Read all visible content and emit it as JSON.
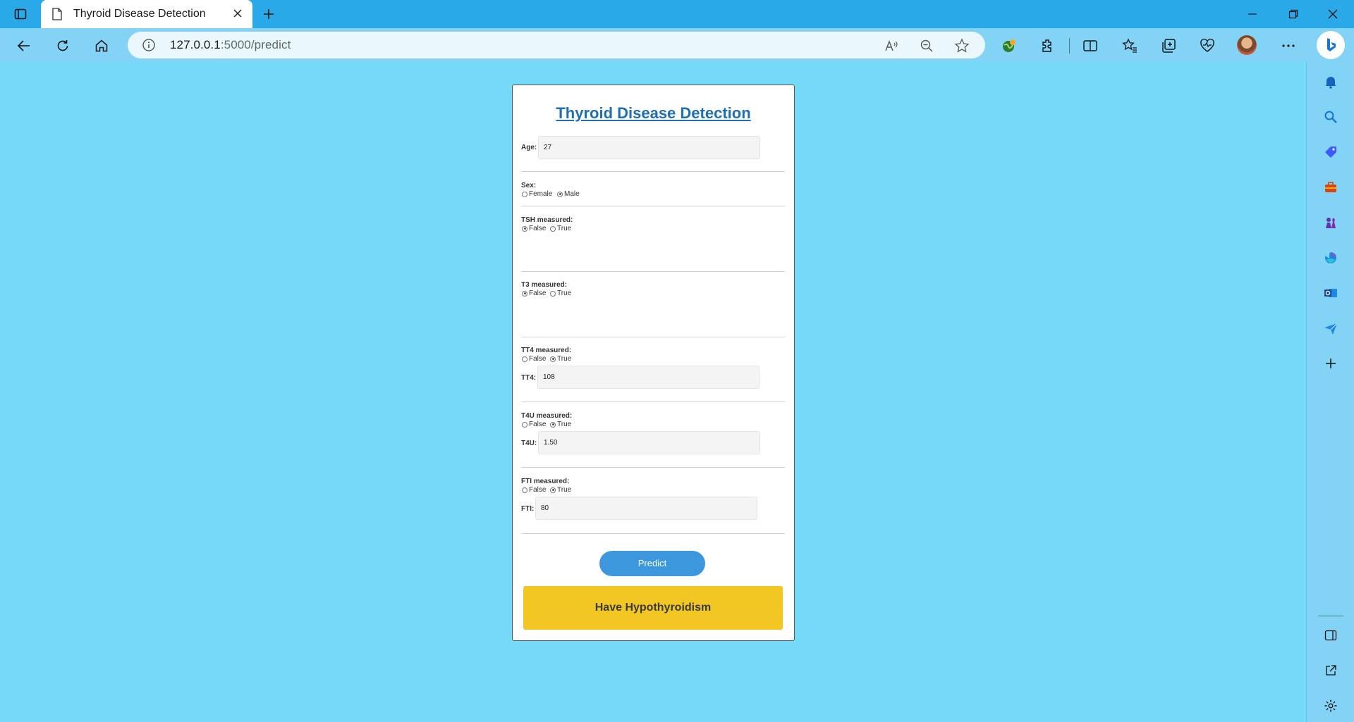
{
  "browser": {
    "tab_title": "Thyroid Disease Detection",
    "url_host": "127.0.0.1",
    "url_path": ":5000/predict"
  },
  "page": {
    "title": "Thyroid Disease Detection",
    "age": {
      "label": "Age:",
      "value": "27"
    },
    "sex": {
      "label": "Sex:",
      "options": [
        "Female",
        "Male"
      ],
      "selected": "Male"
    },
    "tsh": {
      "label": "TSH measured:",
      "options": [
        "False",
        "True"
      ],
      "selected": "False"
    },
    "t3": {
      "label": "T3 measured:",
      "options": [
        "False",
        "True"
      ],
      "selected": "False"
    },
    "tt4": {
      "label": "TT4 measured:",
      "options": [
        "False",
        "True"
      ],
      "selected": "True",
      "value_label": "TT4:",
      "value": "108"
    },
    "t4u": {
      "label": "T4U measured:",
      "options": [
        "False",
        "True"
      ],
      "selected": "True",
      "value_label": "T4U:",
      "value": "1.50"
    },
    "fti": {
      "label": "FTI measured:",
      "options": [
        "False",
        "True"
      ],
      "selected": "True",
      "value_label": "FTI:",
      "value": "80"
    },
    "predict_label": "Predict",
    "result_text": "Have Hypothyroidism"
  },
  "colors": {
    "page_bg": "#75daf7",
    "tabbar_bg": "#2aa9e9",
    "title_color": "#1f6fb2",
    "button_bg": "#3c97dd",
    "result_bg": "#f2c724"
  }
}
